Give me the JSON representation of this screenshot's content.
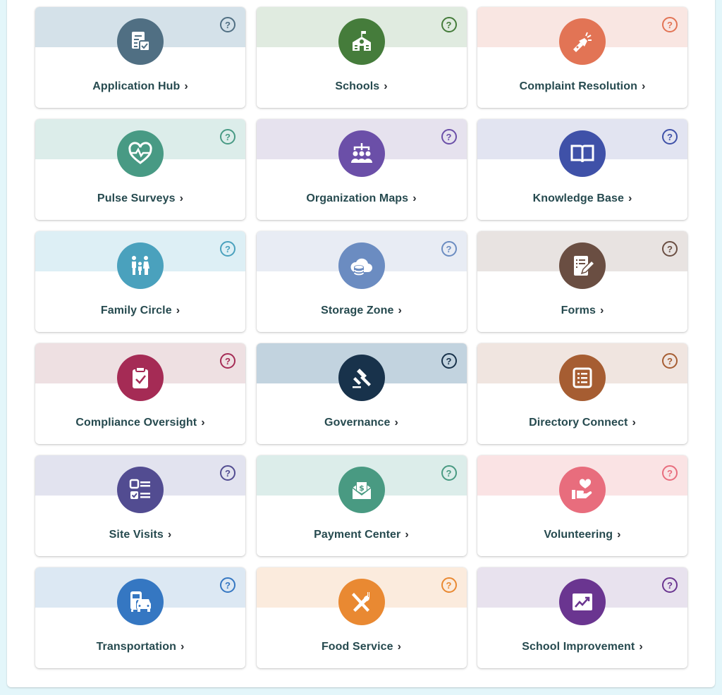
{
  "tiles": [
    {
      "label": "Application Hub",
      "icon": "application-form-icon",
      "color": "#506f83",
      "band": "#d4e1e9"
    },
    {
      "label": "Schools",
      "icon": "school-building-icon",
      "color": "#457c3b",
      "band": "#e0ebe0"
    },
    {
      "label": "Complaint Resolution",
      "icon": "flashlight-icon",
      "color": "#e27455",
      "band": "#f9e6e2"
    },
    {
      "label": "Pulse Surveys",
      "icon": "heart-pulse-icon",
      "color": "#489a84",
      "band": "#dcedea"
    },
    {
      "label": "Organization Maps",
      "icon": "org-chart-icon",
      "color": "#6b4fa8",
      "band": "#e6e2ee"
    },
    {
      "label": "Knowledge Base",
      "icon": "open-book-icon",
      "color": "#3f51a8",
      "band": "#e2e4f1"
    },
    {
      "label": "Family Circle",
      "icon": "family-icon",
      "color": "#4aa1bd",
      "band": "#ddeff5"
    },
    {
      "label": "Storage Zone",
      "icon": "cloud-database-icon",
      "color": "#6b8cc1",
      "band": "#e8ecf4"
    },
    {
      "label": "Forms",
      "icon": "form-edit-icon",
      "color": "#6a4e42",
      "band": "#e8e3e1"
    },
    {
      "label": "Compliance Oversight",
      "icon": "clipboard-check-icon",
      "color": "#a52b55",
      "band": "#eee0e2"
    },
    {
      "label": "Governance",
      "icon": "gavel-icon",
      "color": "#18324b",
      "band": "#c2d3df"
    },
    {
      "label": "Directory Connect",
      "icon": "directory-list-icon",
      "color": "#a65d32",
      "band": "#f0e5e0"
    },
    {
      "label": "Site Visits",
      "icon": "checklist-icon",
      "color": "#524c91",
      "band": "#e2e3ef"
    },
    {
      "label": "Payment Center",
      "icon": "payment-envelope-icon",
      "color": "#499a82",
      "band": "#dcedea"
    },
    {
      "label": "Volunteering",
      "icon": "hand-heart-icon",
      "color": "#e86d7d",
      "band": "#fae3e4"
    },
    {
      "label": "Transportation",
      "icon": "bus-car-icon",
      "color": "#3577c2",
      "band": "#dce8f3"
    },
    {
      "label": "Food Service",
      "icon": "utensils-icon",
      "color": "#e98932",
      "band": "#fbebdd"
    },
    {
      "label": "School Improvement",
      "icon": "trend-chart-icon",
      "color": "#6a3590",
      "band": "#e8e2ee"
    }
  ],
  "help_glyph": "?",
  "chevron_glyph": "›"
}
